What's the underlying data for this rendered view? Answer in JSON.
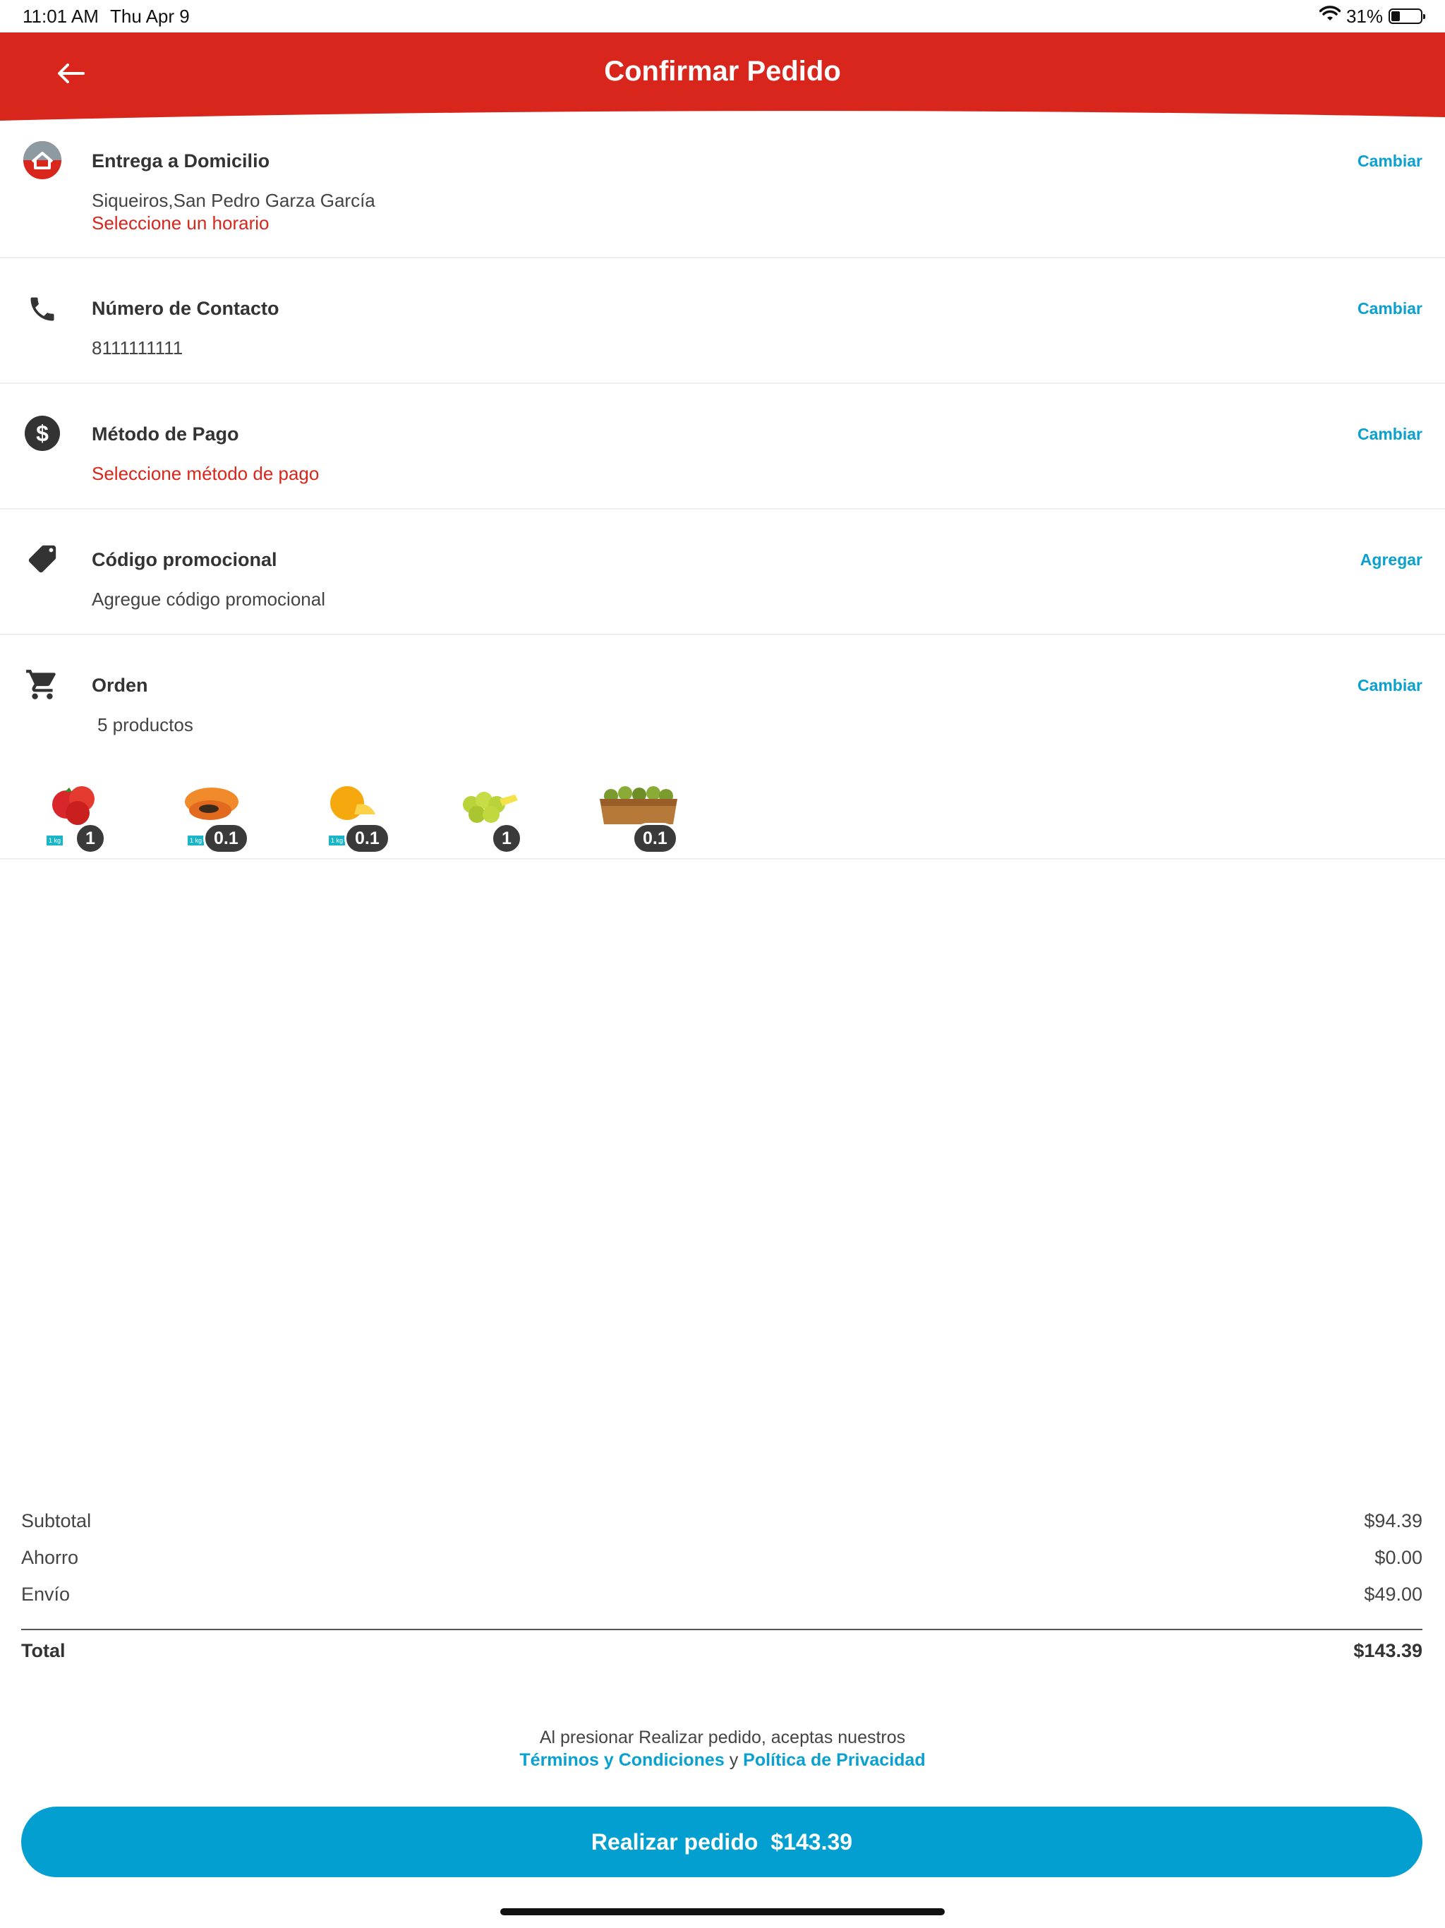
{
  "status_bar": {
    "time": "11:01 AM",
    "date": "Thu Apr 9",
    "battery": "31%",
    "battery_level": 0.31
  },
  "header": {
    "title": "Confirmar Pedido",
    "back_icon": "arrow-left-icon",
    "color": "#d9261c"
  },
  "delivery": {
    "title": "Entrega a Domicilio",
    "action": "Cambiar",
    "address": "Siqueiros,San Pedro Garza García",
    "schedule_prompt": "Seleccione un horario",
    "icon": "home-delivery-icon"
  },
  "contact": {
    "title": "Número de Contacto",
    "action": "Cambiar",
    "phone": "8111111111",
    "icon": "phone-icon"
  },
  "payment": {
    "title": "Método de Pago",
    "action": "Cambiar",
    "prompt": "Seleccione método de pago",
    "icon": "dollar-icon"
  },
  "promo": {
    "title": "Código promocional",
    "action": "Agregar",
    "prompt": "Agregue código promocional",
    "icon": "tag-icon"
  },
  "order": {
    "title": "Orden",
    "action": "Cambiar",
    "count_text": "5 productos",
    "icon": "cart-icon",
    "products": [
      {
        "name": "tomato",
        "qty": "1",
        "tag": "1 kg"
      },
      {
        "name": "papaya",
        "qty": "0.1",
        "tag": "1 kg"
      },
      {
        "name": "orange",
        "qty": "0.1",
        "tag": "1 kg"
      },
      {
        "name": "lime",
        "qty": "1"
      },
      {
        "name": "pear-box",
        "qty": "0.1"
      }
    ]
  },
  "totals": {
    "subtotal_label": "Subtotal",
    "subtotal": "$94.39",
    "savings_label": "Ahorro",
    "savings": "$0.00",
    "shipping_label": "Envío",
    "shipping": "$49.00",
    "total_label": "Total",
    "total": "$143.39"
  },
  "legal": {
    "prefix": "Al presionar Realizar pedido, aceptas nuestros",
    "terms": "Términos y Condiciones",
    "joiner": "y",
    "privacy": "Política de Privacidad"
  },
  "cta": {
    "label": "Realizar pedido",
    "amount": "$143.39",
    "color": "#039fd0"
  },
  "colors": {
    "accent": "#0aa0d0",
    "error": "#d9261c"
  }
}
